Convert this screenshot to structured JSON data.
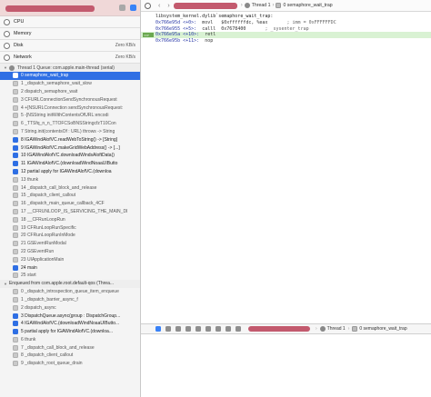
{
  "navigator": {
    "gauges": [
      {
        "label": "CPU",
        "value": ""
      },
      {
        "label": "Memory",
        "value": ""
      },
      {
        "label": "Disk",
        "value": "Zero KB/s"
      },
      {
        "label": "Network",
        "value": "Zero KB/s"
      }
    ],
    "thread": "Thread 1 Queue: com.apple.main-thread (serial)",
    "frames": [
      "0 semaphore_wait_trap",
      "1 _dispatch_semaphore_wait_slow",
      "2 dispatch_semaphore_wait",
      "3 CFURLConnectionSendSynchronousRequest",
      "4 +[NSURLConnection sendSynchronousRequest:",
      "5 -[NSString initWithContentsOfURL:encodi",
      "6 _TTSfq_n_n_TTOFCSoBNSStringcfzT10Con",
      "7 String.init(contentsOf : URL) throws -> String",
      "8 IGAWindAlofVC.readWebToString() -> [String]",
      "9 IGAWindAlofVC.makeGridWebAddress() -> [...]",
      "10 IGAWindAlofVC.downloadWindsAloftData()",
      "11 IGAWindAlofVC.(downloadWindNoaaUIButto",
      "12 partial apply for IGAWindAlofVC.(downloa",
      "13 thunk",
      "14 _dispatch_call_block_and_release",
      "15 _dispatch_client_callout",
      "16 _dispatch_main_queue_callback_4CF",
      "17 __CFRUNLOOP_IS_SERVICING_THE_MAIN_DI",
      "18 __CFRunLoopRun",
      "19 CFRunLoopRunSpecific",
      "20 CFRunLoopRunInMode",
      "21 GSEventRunModal",
      "22 GSEventRun",
      "23 UIApplicationMain",
      "24 main",
      "25 start"
    ],
    "selected_frame_index": 0,
    "app_frame_indices": [
      8,
      9,
      10,
      11,
      12,
      24
    ],
    "queue2": "Enqueued from com.apple.root.default-qos (Threa...",
    "frames2": [
      "0 _dispatch_introspection_queue_item_enqueue",
      "1 _dispatch_barrier_async_f",
      "2 dispatch_async",
      "3 DispatchQueue.async(group : DispatchGroup...",
      "4 IGAWindAlofVC.(downloadWindNoaaUIButto...",
      "5 partial apply for IGAWindAlofVC.(downloa...",
      "6 thunk",
      "7 _dispatch_call_block_and_release",
      "8 _dispatch_client_callout",
      "9 _dispatch_root_queue_drain"
    ],
    "app_frame2_indices": [
      3,
      4,
      5
    ]
  },
  "jumpbar": {
    "thread": "Thread 1",
    "frame": "0 semaphore_wait_trap"
  },
  "code": {
    "header": "libsystem_kernel.dylib`semaphore_wait_trap:",
    "lines": [
      {
        "addr": "0x766e95d <+0>:",
        "instr": "movl   $0xffffffdc, %eax",
        "comment": "; imm = 0xFFFFFFDC",
        "pc": false
      },
      {
        "addr": "0x766e955 <+5>:",
        "instr": "calll  0x7678400",
        "comment": "; _sysenter_trap",
        "pc": false
      },
      {
        "addr": "0x766e95a <+10>:",
        "instr": "retl",
        "comment": "",
        "pc": true
      },
      {
        "addr": "0x766e95b <+11>:",
        "instr": "nop",
        "comment": "",
        "pc": false
      }
    ]
  },
  "debugbar": {
    "thread": "Thread 1",
    "frame": "0 semaphore_wait_trap"
  },
  "colors": {
    "selection": "#2f6fe4",
    "redaction": "#c35a6e",
    "pc_highlight": "#d9f2d3"
  }
}
